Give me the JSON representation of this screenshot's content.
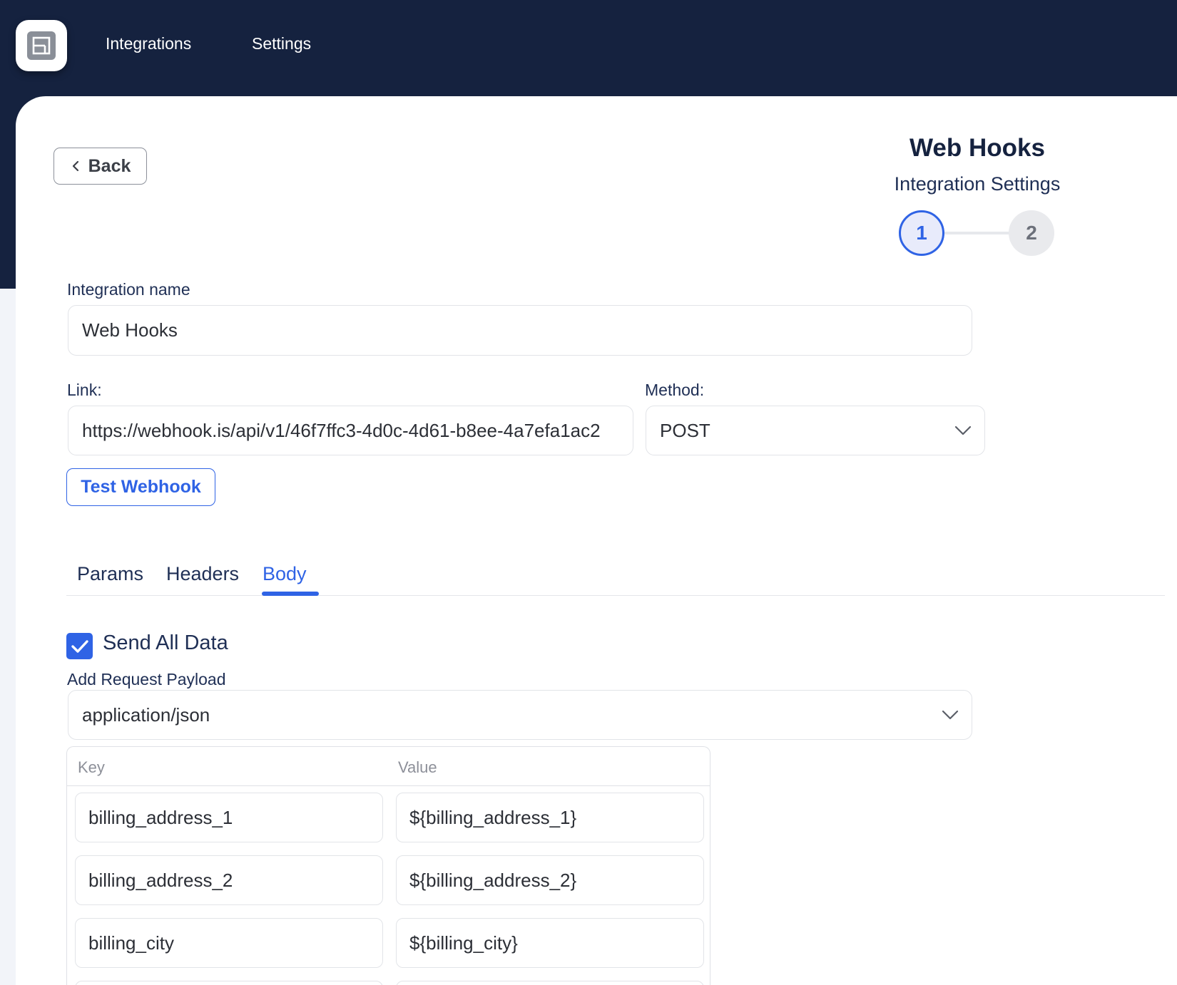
{
  "topbar": {
    "nav": [
      "Integrations",
      "Settings"
    ]
  },
  "header": {
    "back_label": "Back",
    "title": "Web Hooks",
    "subtitle": "Integration Settings",
    "steps": [
      "1",
      "2"
    ],
    "active_step": 1
  },
  "form": {
    "integration_name_label": "Integration name",
    "integration_name_value": "Web Hooks",
    "link_label": "Link:",
    "link_value": "https://webhook.is/api/v1/46f7ffc3-4d0c-4d61-b8ee-4a7efa1ac2",
    "method_label": "Method:",
    "method_value": "POST",
    "test_button": "Test Webhook"
  },
  "tabs": {
    "items": [
      "Params",
      "Headers",
      "Body"
    ],
    "active": "Body"
  },
  "body": {
    "send_all_label": "Send All Data",
    "send_all_checked": true,
    "payload_label": "Add Request Payload",
    "payload_type": "application/json",
    "table": {
      "key_header": "Key",
      "value_header": "Value",
      "rows": [
        {
          "key": "billing_address_1",
          "value": "${billing_address_1}"
        },
        {
          "key": "billing_address_2",
          "value": "${billing_address_2}"
        },
        {
          "key": "billing_city",
          "value": "${billing_city}"
        }
      ]
    }
  },
  "colors": {
    "nav_bg": "#15223f",
    "accent": "#2f63e5"
  }
}
